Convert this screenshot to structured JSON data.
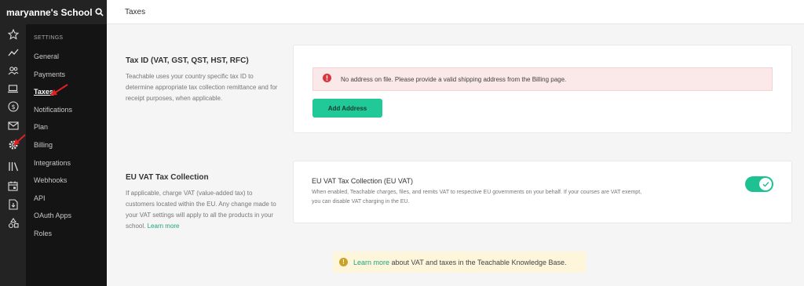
{
  "school": {
    "name": "maryanne's School"
  },
  "rail": {
    "icons": [
      "star-icon",
      "trend-icon",
      "users-icon",
      "laptop-icon",
      "dollar-icon",
      "mail-icon",
      "gear-icon",
      "library-icon",
      "calendar-icon",
      "download-doc-icon",
      "shapes-icon"
    ]
  },
  "settings_nav": {
    "heading": "SETTINGS",
    "items": [
      {
        "label": "General"
      },
      {
        "label": "Payments"
      },
      {
        "label": "Taxes",
        "active": true
      },
      {
        "label": "Notifications"
      },
      {
        "label": "Plan"
      },
      {
        "label": "Billing"
      },
      {
        "label": "Integrations"
      },
      {
        "label": "Webhooks"
      },
      {
        "label": "API"
      },
      {
        "label": "OAuth Apps"
      },
      {
        "label": "Roles"
      }
    ]
  },
  "header": {
    "title": "Taxes"
  },
  "tax_id": {
    "title": "Tax ID (VAT, GST, QST, HST, RFC)",
    "description": "Teachable uses your country specific tax ID to determine appropriate tax collection remittance and for receipt purposes, when applicable.",
    "alert": "No address on file. Please provide a valid shipping address from the Billing page.",
    "button": "Add Address"
  },
  "eu_vat": {
    "title": "EU VAT Tax Collection",
    "description": "If applicable, charge VAT (value-added tax) to customers located within the EU. Any change made to your VAT settings will apply to all the products in your school.",
    "learn_more": "Learn more",
    "card_title": "EU VAT Tax Collection (EU VAT)",
    "card_description": "When enabled, Teachable charges, files, and remits VAT to respective EU governments on your behalf. If your courses are VAT exempt, you can disable VAT charging in the EU.",
    "toggle_on": true
  },
  "notice": {
    "link": "Learn more",
    "text": " about VAT and taxes in the Teachable Knowledge Base."
  },
  "colors": {
    "accent": "#20c997",
    "annotation_arrow": "#e02020",
    "alert_bg": "#fbe8e8",
    "notice_bg": "#fdf6db"
  }
}
